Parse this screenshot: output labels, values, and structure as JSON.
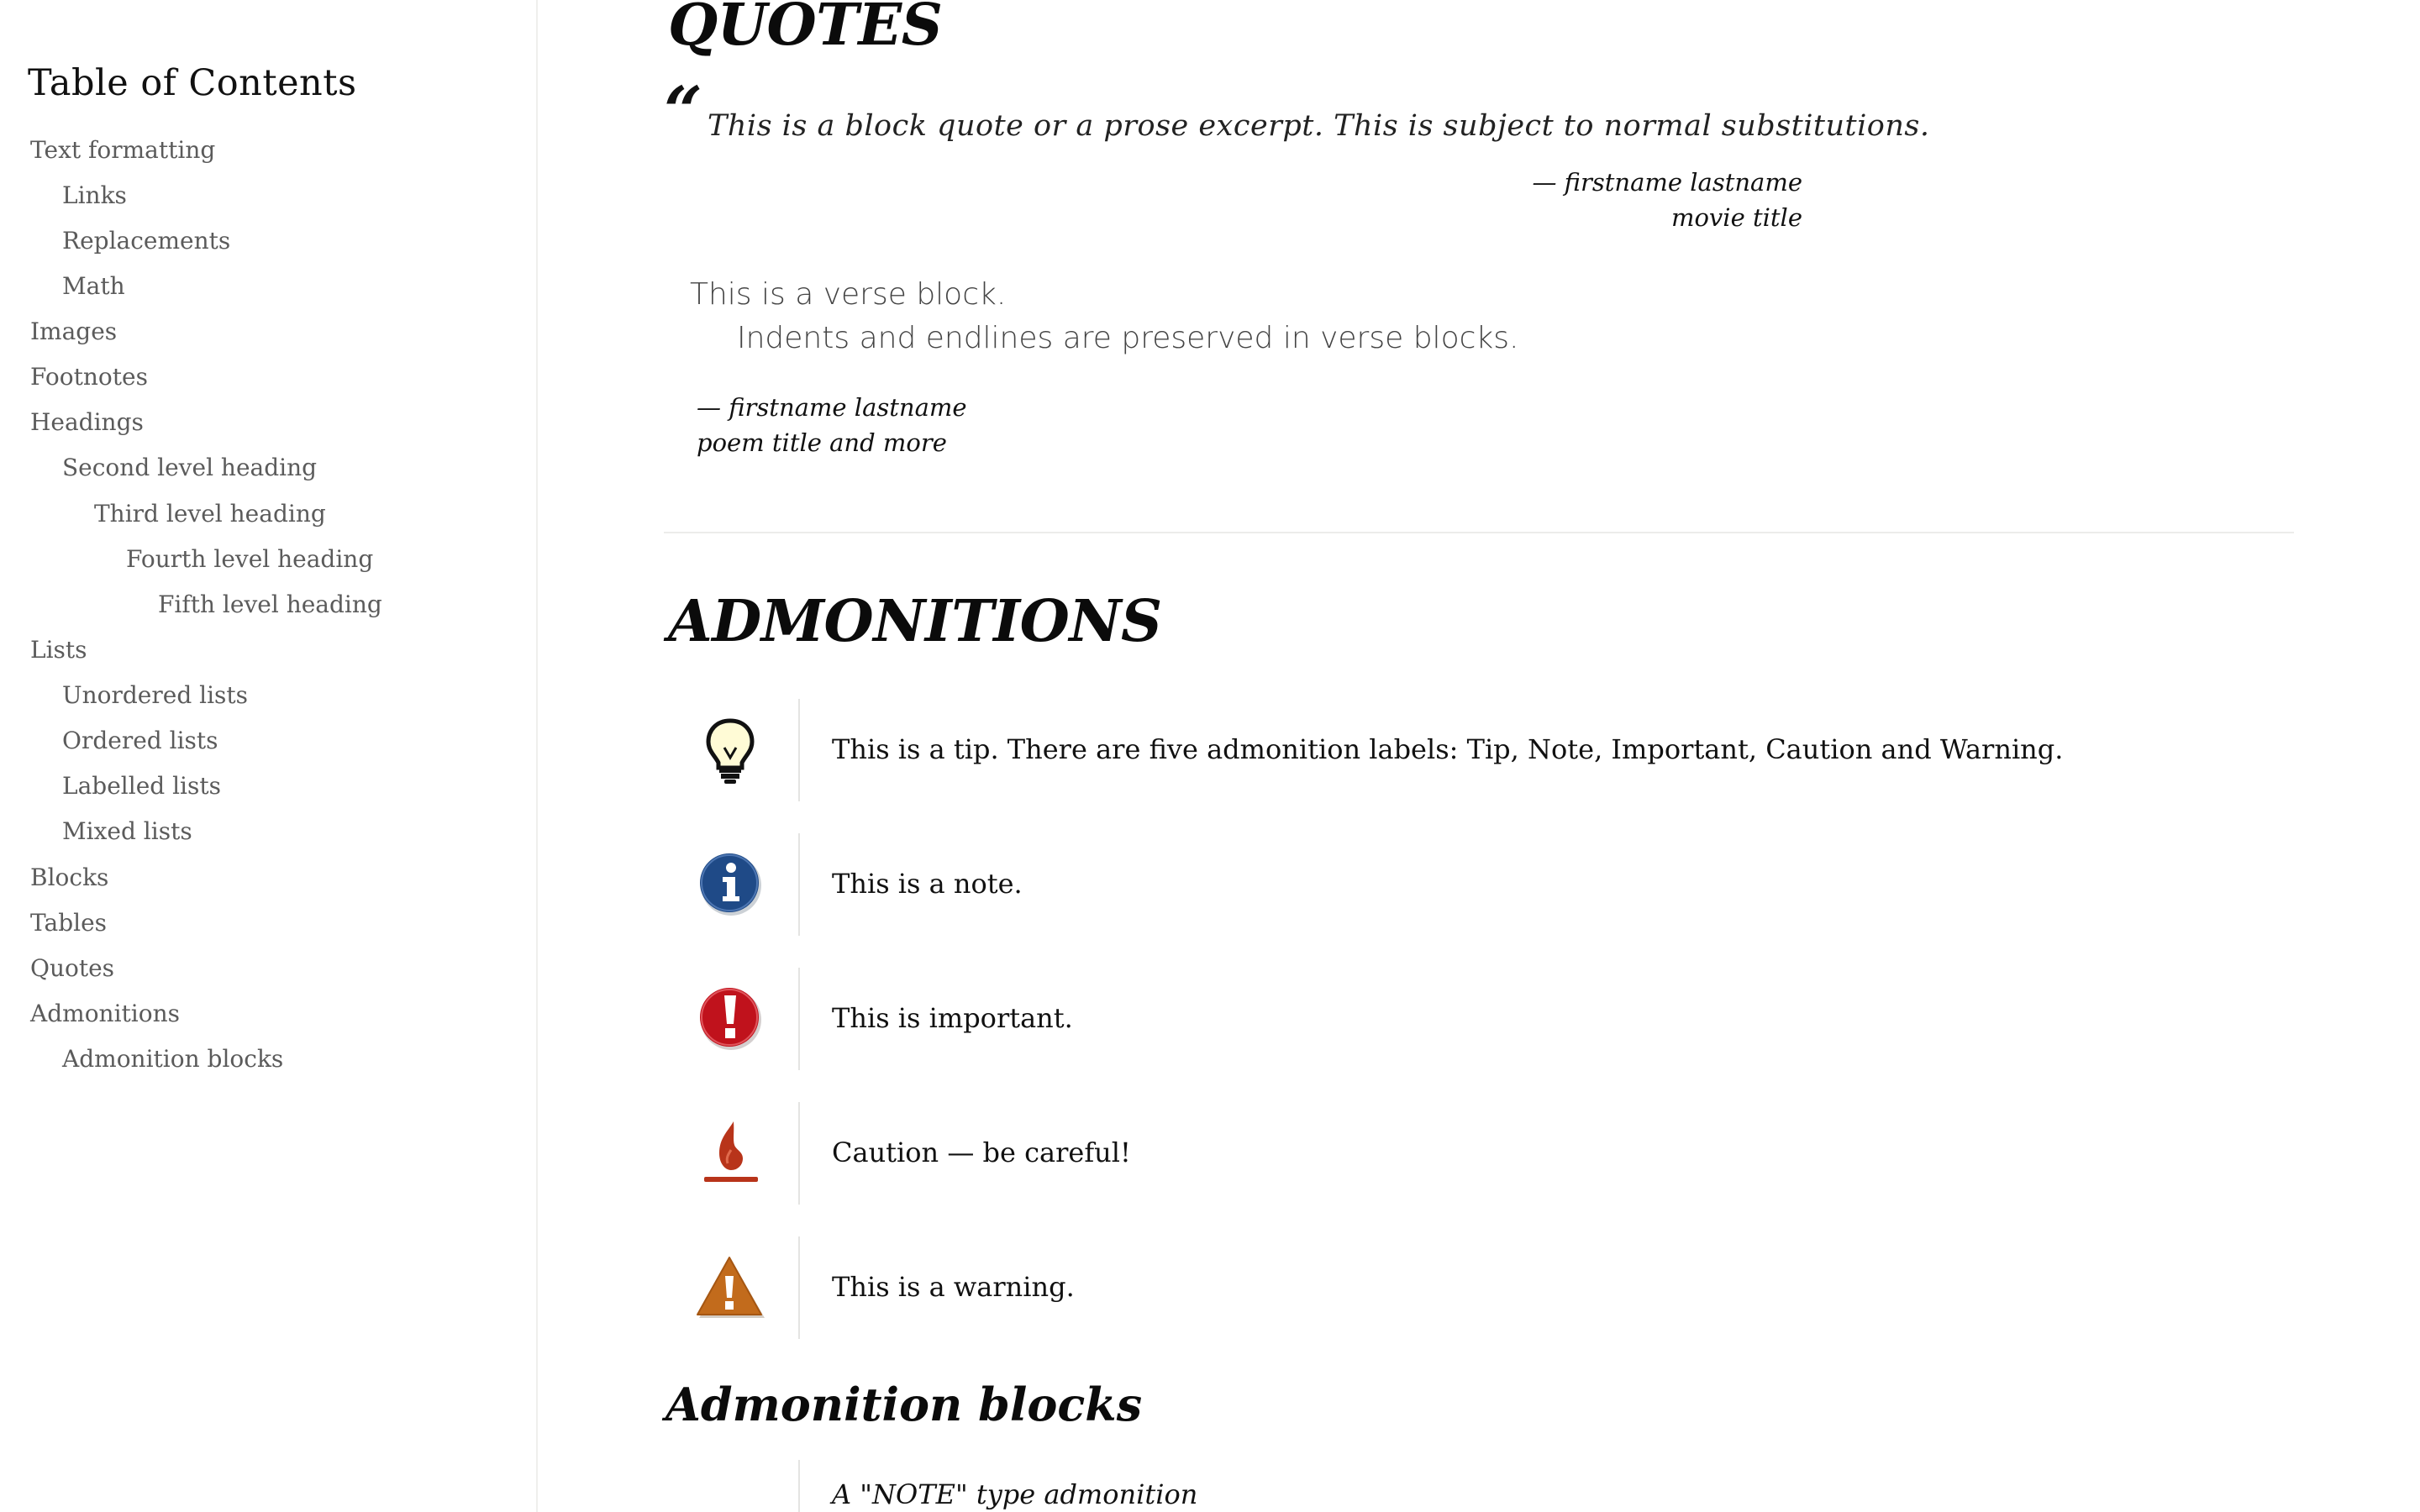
{
  "sidebar": {
    "title": "Table of Contents",
    "items": [
      {
        "label": "Text formatting"
      },
      {
        "label": "Links"
      },
      {
        "label": "Replacements"
      },
      {
        "label": "Math"
      },
      {
        "label": "Images"
      },
      {
        "label": "Footnotes"
      },
      {
        "label": "Headings"
      },
      {
        "label": "Second level heading"
      },
      {
        "label": "Third level heading"
      },
      {
        "label": "Fourth level heading"
      },
      {
        "label": "Fifth level heading"
      },
      {
        "label": "Lists"
      },
      {
        "label": "Unordered lists"
      },
      {
        "label": "Ordered lists"
      },
      {
        "label": "Labelled lists"
      },
      {
        "label": "Mixed lists"
      },
      {
        "label": "Blocks"
      },
      {
        "label": "Tables"
      },
      {
        "label": "Quotes"
      },
      {
        "label": "Admonitions"
      },
      {
        "label": "Admonition blocks"
      }
    ]
  },
  "quotes": {
    "heading": "QUOTES",
    "quote_mark": "“",
    "block_quote": "This is a block quote or a prose excerpt. This is subject to normal substitutions.",
    "attribution": "— firstname lastname",
    "citation": "movie title",
    "verse_line1": "This is a verse block.",
    "verse_line2": "Indents and endlines are preserved in verse blocks.",
    "verse_attribution": "— firstname lastname",
    "verse_citation": "poem title and more"
  },
  "admonitions": {
    "heading": "ADMONITIONS",
    "items": [
      {
        "icon": "lightbulb-icon",
        "text": "This is a tip. There are five admonition labels: Tip, Note, Important, Caution and Warning."
      },
      {
        "icon": "info-icon",
        "text": "This is a note."
      },
      {
        "icon": "exclamation-icon",
        "text": "This is important."
      },
      {
        "icon": "flame-icon",
        "text": "Caution — be careful!"
      },
      {
        "icon": "warning-triangle-icon",
        "text": "This is a warning."
      }
    ],
    "colors": {
      "note": "#1f4a87",
      "important": "#c0121c",
      "caution": "#b8341a",
      "warning": "#c26b1c"
    }
  },
  "admonition_blocks": {
    "heading": "Admonition blocks",
    "first_block_title": "A \"NOTE\" type admonition"
  }
}
